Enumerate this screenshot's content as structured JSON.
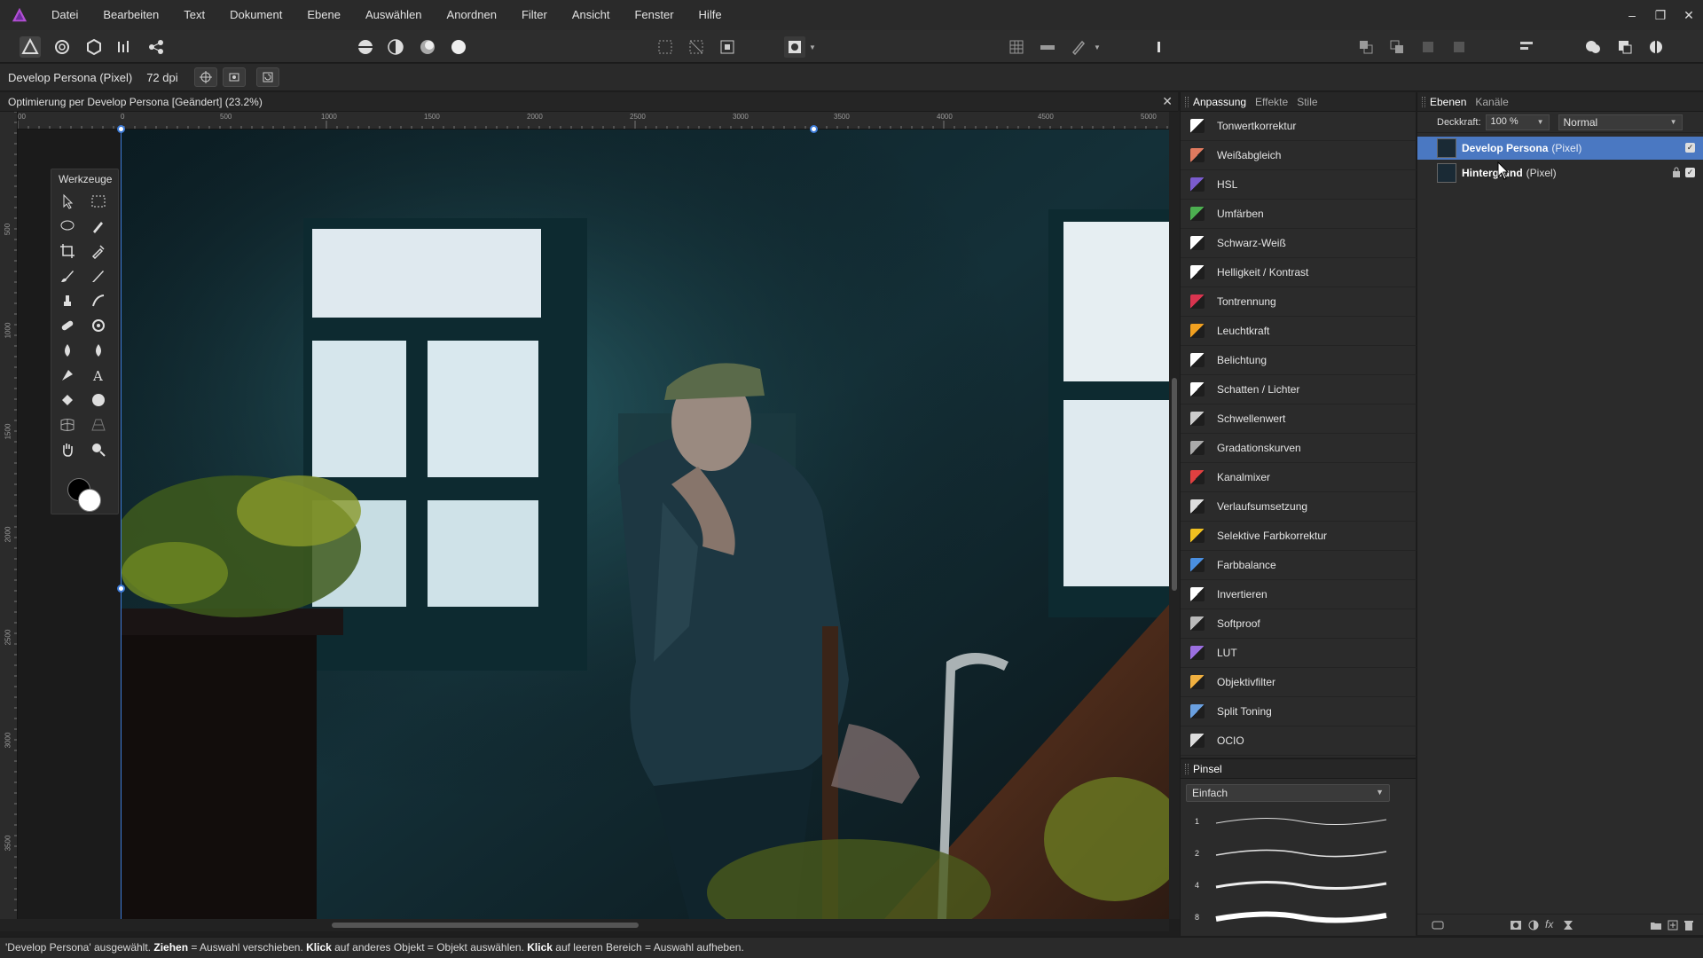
{
  "menu": [
    "Datei",
    "Bearbeiten",
    "Text",
    "Dokument",
    "Ebene",
    "Auswählen",
    "Anordnen",
    "Filter",
    "Ansicht",
    "Fenster",
    "Hilfe"
  ],
  "window_controls": {
    "minimize": "–",
    "restore": "❐",
    "close": "✕"
  },
  "context": {
    "persona": "Develop Persona (Pixel)",
    "dpi": "72 dpi"
  },
  "document": {
    "title": "Optimierung per Develop Persona [Geändert] (23.2%)",
    "close": "✕"
  },
  "ruler": {
    "h_ticks": [
      "00",
      "0",
      "500",
      "1000",
      "1500",
      "2000",
      "2500",
      "3000",
      "3500",
      "4000",
      "4500",
      "5000"
    ],
    "v_ticks": [
      "500",
      "1000",
      "1500",
      "2000",
      "2500",
      "3000",
      "3500"
    ]
  },
  "tools": {
    "title": "Werkzeuge"
  },
  "adjustments": {
    "tabs": [
      "Anpassung",
      "Effekte",
      "Stile"
    ],
    "items": [
      {
        "label": "Tonwertkorrektur",
        "icon": "levels-icon",
        "color": "#ffffff"
      },
      {
        "label": "Weißabgleich",
        "icon": "white-balance-icon",
        "color": "#e07a5f"
      },
      {
        "label": "HSL",
        "icon": "hsl-icon",
        "color": "#7b5ccf"
      },
      {
        "label": "Umfärben",
        "icon": "recolour-icon",
        "color": "#4caf50"
      },
      {
        "label": "Schwarz-Weiß",
        "icon": "black-white-icon",
        "color": "#ffffff"
      },
      {
        "label": "Helligkeit / Kontrast",
        "icon": "brightness-contrast-icon",
        "color": "#ffffff"
      },
      {
        "label": "Tontrennung",
        "icon": "posterize-icon",
        "color": "#d9344f"
      },
      {
        "label": "Leuchtkraft",
        "icon": "vibrance-icon",
        "color": "#f0a020"
      },
      {
        "label": "Belichtung",
        "icon": "exposure-icon",
        "color": "#ffffff"
      },
      {
        "label": "Schatten / Lichter",
        "icon": "shadows-highlights-icon",
        "color": "#ffffff"
      },
      {
        "label": "Schwellenwert",
        "icon": "threshold-icon",
        "color": "#cccccc"
      },
      {
        "label": "Gradationskurven",
        "icon": "curves-icon",
        "color": "#aaaaaa"
      },
      {
        "label": "Kanalmixer",
        "icon": "channel-mixer-icon",
        "color": "#e04040"
      },
      {
        "label": "Verlaufsumsetzung",
        "icon": "gradient-map-icon",
        "color": "#dddddd"
      },
      {
        "label": "Selektive Farbkorrektur",
        "icon": "selective-colour-icon",
        "color": "#f0c020"
      },
      {
        "label": "Farbbalance",
        "icon": "colour-balance-icon",
        "color": "#4a8fe0"
      },
      {
        "label": "Invertieren",
        "icon": "invert-icon",
        "color": "#ffffff"
      },
      {
        "label": "Softproof",
        "icon": "soft-proof-icon",
        "color": "#bbbbbb"
      },
      {
        "label": "LUT",
        "icon": "lut-icon",
        "color": "#9b6fe0"
      },
      {
        "label": "Objektivfilter",
        "icon": "lens-filter-icon",
        "color": "#f0b040"
      },
      {
        "label": "Split Toning",
        "icon": "split-toning-icon",
        "color": "#6aa0e0"
      },
      {
        "label": "OCIO",
        "icon": "ocio-icon",
        "color": "#dddddd"
      }
    ]
  },
  "brushes": {
    "title": "Pinsel",
    "category": "Einfach",
    "sizes": [
      "1",
      "2",
      "4",
      "8"
    ]
  },
  "layers": {
    "tabs": [
      "Ebenen",
      "Kanäle"
    ],
    "opacity_label": "Deckkraft:",
    "opacity_value": "100 %",
    "blend_mode": "Normal",
    "items": [
      {
        "name": "Develop Persona",
        "type": "(Pixel)",
        "selected": true
      },
      {
        "name": "Hintergrund",
        "type": "(Pixel)",
        "selected": false
      }
    ]
  },
  "status": {
    "part1": "'Develop Persona' ausgewählt. ",
    "b1": "Ziehen",
    "part2": " = Auswahl verschieben. ",
    "b2": "Klick",
    "part3": " auf anderes Objekt = Objekt auswählen. ",
    "b3": "Klick",
    "part4": " auf leeren Bereich = Auswahl aufheben."
  }
}
